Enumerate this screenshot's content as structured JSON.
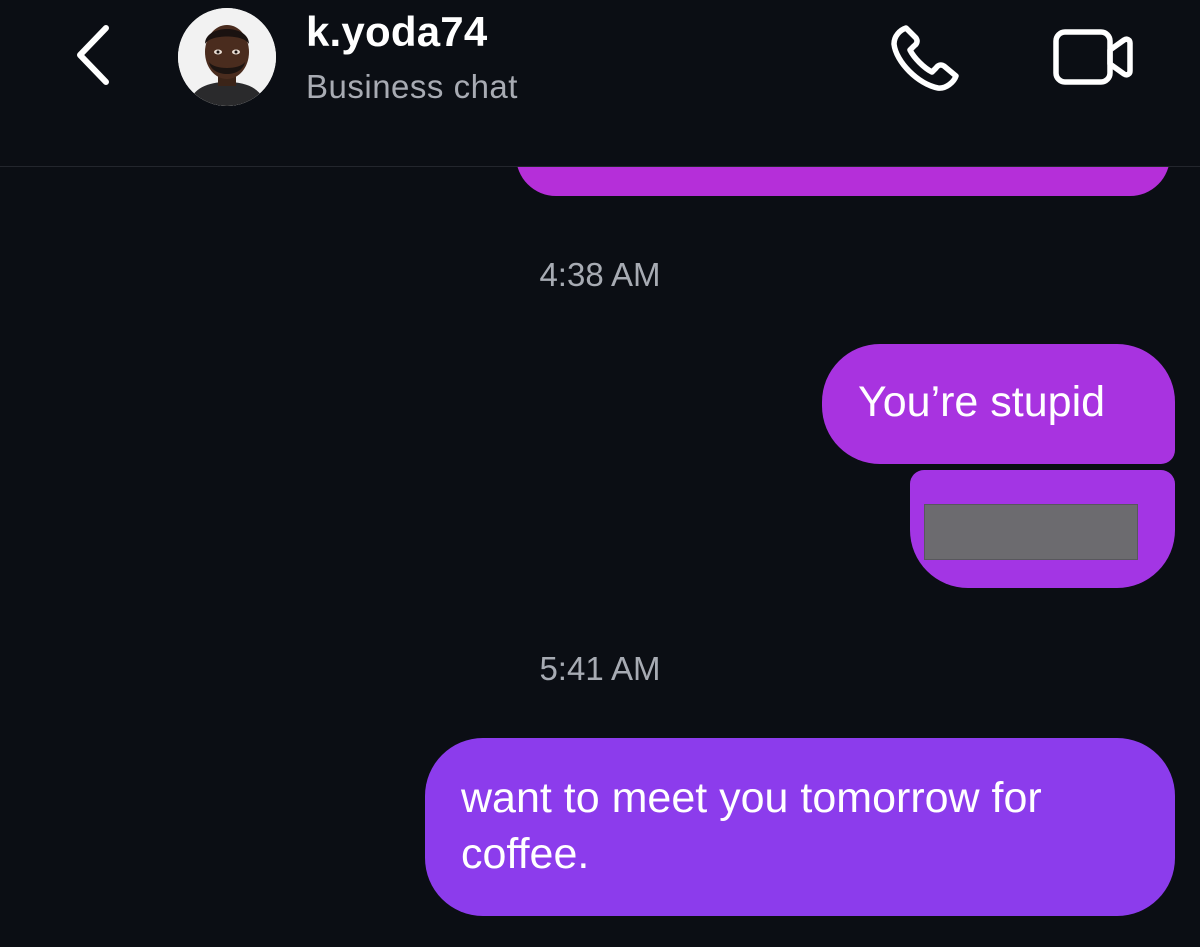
{
  "header": {
    "contact_name": "k.yoda74",
    "contact_subtitle": "Business chat",
    "back_icon": "chevron-left-icon",
    "call_icon": "phone-icon",
    "video_icon": "video-camera-icon"
  },
  "messages": [
    {
      "type": "timestamp",
      "text": "4:38 AM"
    },
    {
      "type": "outgoing",
      "text": "You’re stupid"
    },
    {
      "type": "outgoing",
      "text": "",
      "content": "redacted"
    },
    {
      "type": "timestamp",
      "text": "5:41 AM"
    },
    {
      "type": "outgoing",
      "text": "want to meet you tomorrow for coffee."
    }
  ],
  "colors": {
    "background": "#0b0e14",
    "bubble_top": "#b52fd9",
    "bubble_mid": "#a833e0",
    "bubble_bottom": "#8c3cec",
    "timestamp": "#a7abb3",
    "subtitle": "#a8abb3"
  }
}
